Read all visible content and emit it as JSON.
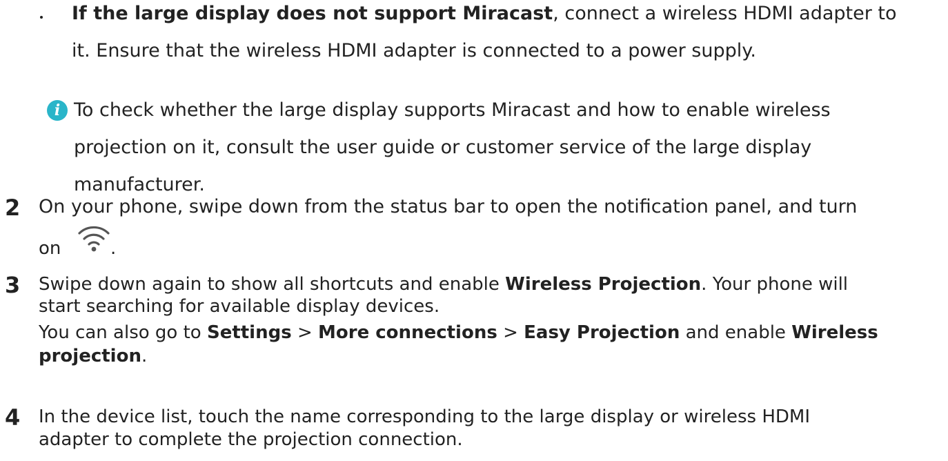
{
  "bullet": {
    "bold": "If the large display does not support Miracast",
    "rest": ", connect a wireless HDMI adapter to",
    "line2": "it. Ensure that the wireless HDMI adapter is connected to a power supply."
  },
  "note": {
    "line1": "To check whether the large display supports Miracast and how to enable wireless",
    "line2": "projection on it, consult the user guide or customer service of the large display",
    "line3": "manufacturer."
  },
  "step2": {
    "number": "2",
    "line1": "On your phone, swipe down from the status bar to open the notification panel, and turn",
    "on": "on",
    "period": "."
  },
  "step3": {
    "number": "3",
    "l1_a": "Swipe down again to show all shortcuts and enable ",
    "l1_b": "Wireless Projection",
    "l1_c": ". Your phone will",
    "l2": "start searching for available display devices.",
    "l3_a": "You can also go to ",
    "l3_b": "Settings",
    "l3_c": " > ",
    "l3_d": "More connections",
    "l3_e": " > ",
    "l3_f": "Easy Projection",
    "l3_g": " and enable ",
    "l3_h": "Wireless",
    "l4_a": "projection",
    "l4_b": "."
  },
  "step4": {
    "number": "4",
    "line1": "In the device list, touch the name corresponding to the large display or wireless HDMI",
    "line2": "adapter to complete the projection connection."
  },
  "icons": {
    "note": "info-icon",
    "wifi": "wifi-icon",
    "note_color": "#2AB5C9",
    "wifi_color": "#555555"
  }
}
